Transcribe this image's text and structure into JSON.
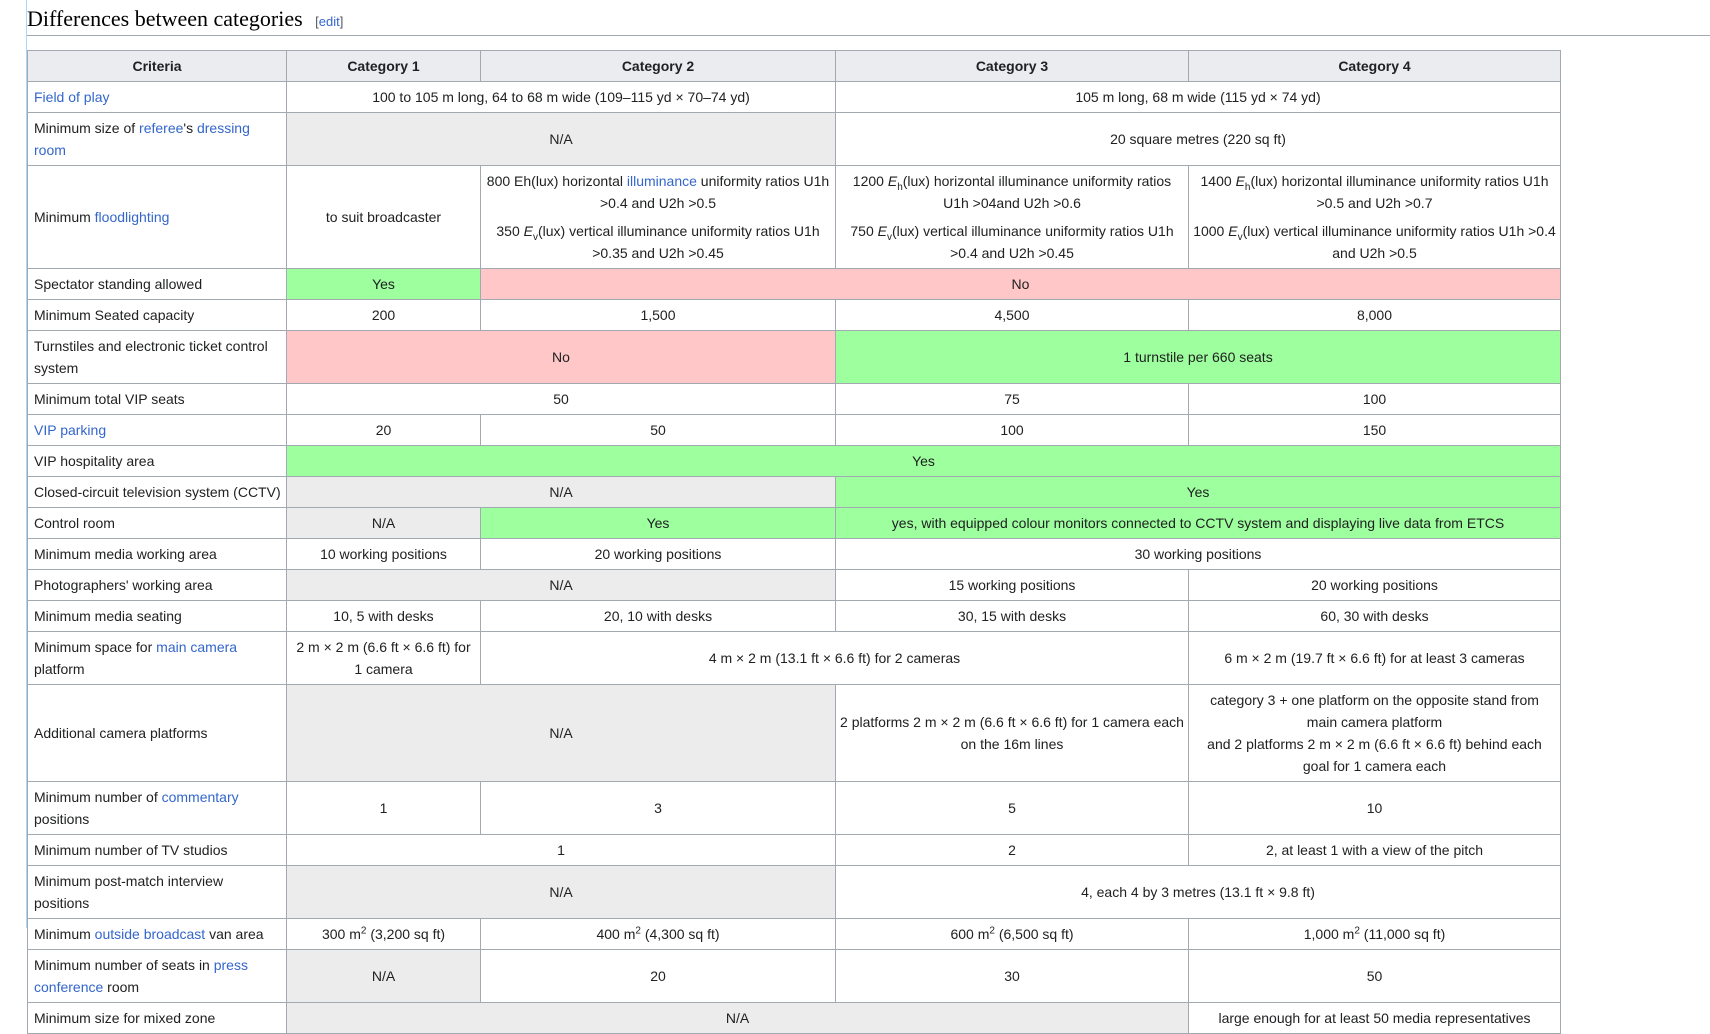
{
  "section": {
    "title": "Differences between categories",
    "edit_open": "[",
    "edit_label": "edit",
    "edit_close": "]"
  },
  "table": {
    "headers": [
      "Criteria",
      "Category 1",
      "Category 2",
      "Category 3",
      "Category 4"
    ],
    "rows": {
      "field": {
        "criteria": "Field of play",
        "c12": "100 to 105 m long, 64 to 68 m wide (109–115 yd × 70–74 yd)",
        "c34": "105 m long, 68 m wide (115 yd × 74 yd)"
      },
      "dressing": {
        "criteria_pre": "Minimum size of ",
        "criteria_link1": "referee",
        "criteria_mid": "'s ",
        "criteria_link2": "dressing room",
        "c12": "N/A",
        "c34": "20 square metres (220 sq ft)"
      },
      "flood": {
        "criteria_pre": "Minimum ",
        "criteria_link": "floodlighting",
        "c1": "to suit broadcaster",
        "c2_h_pre": "800 Eh(lux) horizontal ",
        "c2_h_link": "illuminance",
        "c2_h_post": " uniformity ratios U1h >0.4 and U2h >0.5",
        "c2_v_pre": "350 ",
        "c2_v_sym": "E",
        "c2_v_sub": "v",
        "c2_v_post": "(lux) vertical illuminance uniformity ratios U1h >0.35 and U2h >0.45",
        "c3_h_pre": "1200 ",
        "c3_h_sym": "E",
        "c3_h_sub": "h",
        "c3_h_post": "(lux) horizontal illuminance uniformity ratios U1h >04and U2h >0.6",
        "c3_v_pre": "750 ",
        "c3_v_sym": "E",
        "c3_v_sub": "v",
        "c3_v_post": "(lux) vertical illuminance uniformity ratios U1h >0.4 and U2h >0.45",
        "c4_h_pre": "1400 ",
        "c4_h_sym": "E",
        "c4_h_sub": "h",
        "c4_h_post": "(lux) horizontal illuminance uniformity ratios U1h >0.5 and U2h >0.7",
        "c4_v_pre": "1000 ",
        "c4_v_sym": "E",
        "c4_v_sub": "v",
        "c4_v_post": "(lux) vertical illuminance uniformity ratios U1h >0.4 and U2h >0.5"
      },
      "standing": {
        "criteria": "Spectator standing allowed",
        "c1": "Yes",
        "c234": "No"
      },
      "seated": {
        "criteria": "Minimum Seated capacity",
        "c1": "200",
        "c2": "1,500",
        "c3": "4,500",
        "c4": "8,000"
      },
      "turnstiles": {
        "criteria": "Turnstiles and electronic ticket control system",
        "c12": "No",
        "c34": "1 turnstile per 660 seats"
      },
      "vip_seats": {
        "criteria": "Minimum total VIP seats",
        "c12": "50",
        "c3": "75",
        "c4": "100"
      },
      "vip_parking": {
        "criteria": "VIP parking",
        "c1": "20",
        "c2": "50",
        "c3": "100",
        "c4": "150"
      },
      "hospitality": {
        "criteria": "VIP hospitality area",
        "c1234": "Yes"
      },
      "cctv": {
        "criteria": "Closed-circuit television system (CCTV)",
        "c12": "N/A",
        "c34": "Yes"
      },
      "control": {
        "criteria": "Control room",
        "c1": "N/A",
        "c2": "Yes",
        "c34": "yes, with equipped colour monitors connected to CCTV system and displaying live data from ETCS"
      },
      "media_area": {
        "criteria": "Minimum media working area",
        "c1": "10 working positions",
        "c2": "20 working positions",
        "c34": "30 working positions"
      },
      "photographers": {
        "criteria": "Photographers' working area",
        "c12": "N/A",
        "c3": "15 working positions",
        "c4": "20 working positions"
      },
      "media_seating": {
        "criteria": "Minimum media seating",
        "c1": "10, 5 with desks",
        "c2": "20, 10 with desks",
        "c3": "30, 15 with desks",
        "c4": "60, 30 with desks"
      },
      "camera": {
        "criteria_pre": "Minimum space for ",
        "criteria_link": "main camera",
        "criteria_post": " platform",
        "c1": "2 m × 2 m (6.6 ft × 6.6 ft) for 1 camera",
        "c23": "4 m × 2 m (13.1 ft × 6.6 ft) for 2 cameras",
        "c4": "6 m × 2 m (19.7 ft × 6.6 ft) for at least 3 cameras"
      },
      "add_camera": {
        "criteria": "Additional camera platforms",
        "c12": "N/A",
        "c3": "2 platforms 2 m × 2 m (6.6 ft × 6.6 ft) for 1 camera each on the 16m lines",
        "c4_line1": "category 3 + one platform on the opposite stand from main camera platform",
        "c4_line2": "and 2 platforms 2 m × 2 m (6.6 ft × 6.6 ft) behind each goal for 1 camera each"
      },
      "commentary": {
        "criteria_pre": "Minimum number of ",
        "criteria_link": "commentary",
        "criteria_post": " positions",
        "c1": "1",
        "c2": "3",
        "c3": "5",
        "c4": "10"
      },
      "tv_studios": {
        "criteria": "Minimum number of TV studios",
        "c12": "1",
        "c3": "2",
        "c4": "2, at least 1 with a view of the pitch"
      },
      "interview": {
        "criteria": "Minimum post-match interview positions",
        "c12": "N/A",
        "c34": "4, each 4 by 3 metres (13.1 ft × 9.8 ft)"
      },
      "ob_van": {
        "criteria_pre": "Minimum ",
        "criteria_link": "outside broadcast",
        "criteria_post": " van area",
        "sup": "2",
        "c1_pre": "300 m",
        "c1_post": " (3,200 sq ft)",
        "c2_pre": "400 m",
        "c2_post": " (4,300 sq ft)",
        "c3_pre": "600 m",
        "c3_post": " (6,500 sq ft)",
        "c4_pre": "1,000 m",
        "c4_post": " (11,000 sq ft)"
      },
      "press": {
        "criteria_pre": "Minimum number of seats in ",
        "criteria_link": "press conference",
        "criteria_post": " room",
        "c1": "N/A",
        "c2": "20",
        "c3": "30",
        "c4": "50"
      },
      "mixed_zone": {
        "criteria": "Minimum size for mixed zone",
        "c123": "N/A",
        "c4": "large enough for at least 50 media representatives"
      }
    }
  }
}
